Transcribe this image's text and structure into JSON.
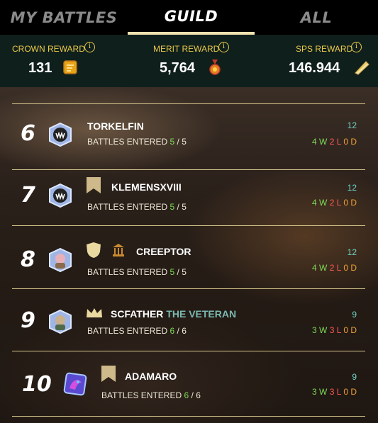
{
  "tabs": [
    {
      "label": "MY BATTLES",
      "active": false
    },
    {
      "label": "GUILD",
      "active": true
    },
    {
      "label": "ALL",
      "active": false
    }
  ],
  "rewards": {
    "crown": {
      "label": "CROWN REWARD",
      "value": "131",
      "icon": "crown-token-icon"
    },
    "merit": {
      "label": "MERIT REWARD",
      "value": "5,764",
      "icon": "merit-medal-icon"
    },
    "sps": {
      "label": "SPS REWARD",
      "value": "146.944",
      "icon": "sps-token-icon"
    }
  },
  "battles_label": "BATTLES ENTERED",
  "players": [
    {
      "rank": "6",
      "name": "TORKELFIN",
      "title": "",
      "entered": "5",
      "total": "5",
      "score": "12",
      "w": "4",
      "l": "2",
      "d": "0",
      "avatar": "monster-avatar",
      "badges": []
    },
    {
      "rank": "7",
      "name": "KLEMENSXVIII",
      "title": "",
      "entered": "5",
      "total": "5",
      "score": "12",
      "w": "4",
      "l": "2",
      "d": "0",
      "avatar": "monster-avatar",
      "badges": [
        "banner-icon"
      ]
    },
    {
      "rank": "8",
      "name": "CREEPTOR",
      "title": "",
      "entered": "5",
      "total": "5",
      "score": "12",
      "w": "4",
      "l": "2",
      "d": "0",
      "avatar": "character-avatar",
      "badges": [
        "shield-icon",
        "temple-icon"
      ]
    },
    {
      "rank": "9",
      "name": "SCFATHER",
      "title": "THE VETERAN",
      "entered": "6",
      "total": "6",
      "score": "9",
      "w": "3",
      "l": "3",
      "d": "0",
      "avatar": "character-avatar",
      "badges": [
        "crown-icon"
      ]
    },
    {
      "rank": "10",
      "name": "ADAMARO",
      "title": "",
      "entered": "6",
      "total": "6",
      "score": "9",
      "w": "3",
      "l": "3",
      "d": "0",
      "avatar": "dragon-avatar",
      "badges": [
        "banner-icon"
      ]
    }
  ],
  "colors": {
    "accent": "#e9c94a",
    "active_tab_underline": "#f1e3b0",
    "win": "#7ed957",
    "loss": "#ff5a5a",
    "draw": "#f0a238",
    "score": "#6fd3c4"
  }
}
